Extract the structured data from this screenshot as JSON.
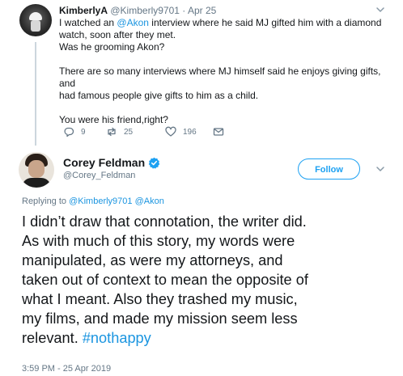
{
  "parent_tweet": {
    "name": "KimberlyA",
    "handle": "@Kimberly9701",
    "separator": "·",
    "time": "Apr 25",
    "lines": [
      [
        "I watched an ",
        "@Akon",
        " interview where he said MJ gifted him with a diamond"
      ],
      "watch, soon after they met.",
      "Was he grooming Akon?",
      "There are so many interviews where MJ himself said he enjoys giving gifts, and",
      "had famous people give gifts to him as a child.",
      "You were his friend,right?"
    ],
    "actions": {
      "replies": "9",
      "retweets": "25",
      "likes": "196"
    }
  },
  "main_tweet": {
    "name": "Corey Feldman",
    "handle": "@Corey_Feldman",
    "follow_label": "Follow",
    "replying_prefix": "Replying to",
    "replying_to": [
      "@Kimberly9701",
      "@Akon"
    ],
    "lines": [
      "I didn’t draw that connotation, the writer did.",
      "As with much of this story, my words were",
      "manipulated, as were my attorneys, and",
      "taken out of context to mean the opposite of",
      "what I meant. Also they trashed my music,",
      "my films, and made my mission seem less",
      "relevant. "
    ],
    "hashtag": "#nothappy",
    "timestamp": "3:59 PM - 25 Apr 2019"
  },
  "colors": {
    "accent": "#1da1f2",
    "link": "#1b95e0",
    "muted": "#657786",
    "text": "#14171a",
    "verified": "#1da1f2"
  },
  "icons": [
    "reply-icon",
    "retweet-icon",
    "like-icon",
    "direct-message-icon",
    "chevron-down-icon",
    "verified-badge-icon"
  ]
}
